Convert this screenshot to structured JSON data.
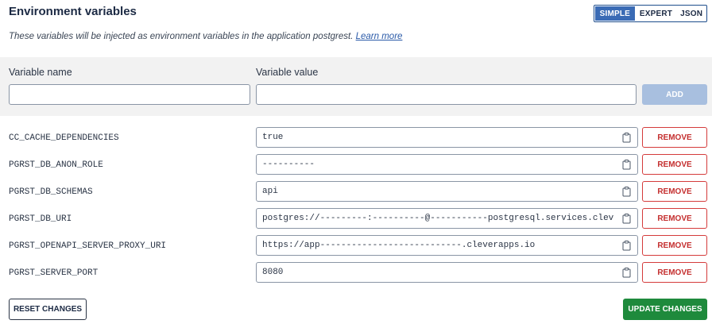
{
  "header": {
    "title": "Environment variables",
    "modes": [
      "SIMPLE",
      "EXPERT",
      "JSON"
    ],
    "active_mode": "SIMPLE"
  },
  "description": {
    "text": "These variables will be injected as environment variables in the application postgrest. ",
    "link": "Learn more"
  },
  "new_variable": {
    "name_label": "Variable name",
    "value_label": "Variable value",
    "name_value": "",
    "value_value": "",
    "add_label": "ADD"
  },
  "variables": [
    {
      "name": "CC_CACHE_DEPENDENCIES",
      "value": "true"
    },
    {
      "name": "PGRST_DB_ANON_ROLE",
      "value": "----------"
    },
    {
      "name": "PGRST_DB_SCHEMAS",
      "value": "api"
    },
    {
      "name": "PGRST_DB_URI",
      "value": "postgres://---------:----------@-----------postgresql.services.clev"
    },
    {
      "name": "PGRST_OPENAPI_SERVER_PROXY_URI",
      "value": "https://app---------------------------.cleverapps.io"
    },
    {
      "name": "PGRST_SERVER_PORT",
      "value": "8080"
    }
  ],
  "remove_label": "REMOVE",
  "footer": {
    "reset_label": "RESET CHANGES",
    "update_label": "UPDATE CHANGES"
  },
  "icons": {
    "copy": "clipboard-icon"
  }
}
